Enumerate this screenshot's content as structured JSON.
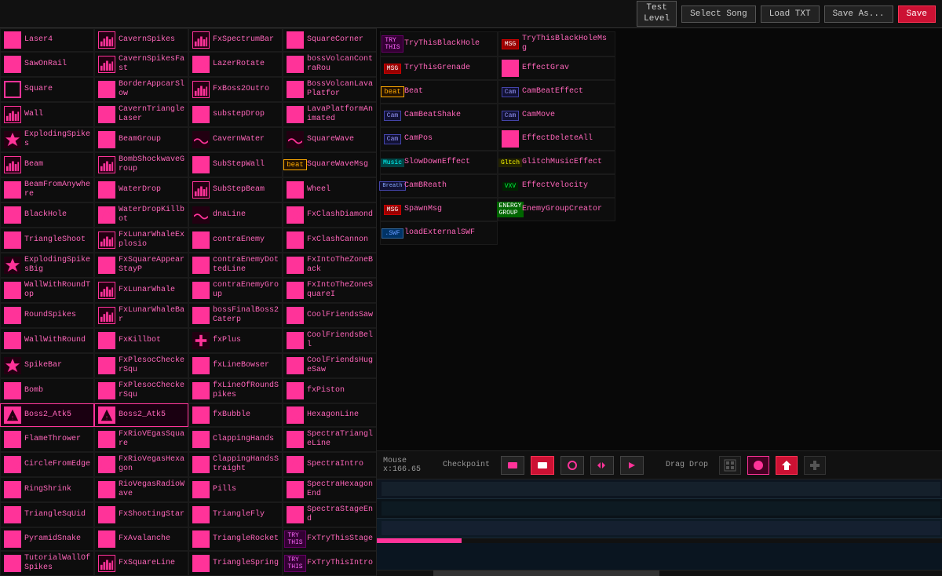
{
  "topbar": {
    "test_level": "Test\nLevel",
    "select_song": "Select Song",
    "load_txt": "Load TXT",
    "save_as": "Save As...",
    "save": "Save"
  },
  "mouse": {
    "label": "Mouse",
    "x": "x:166.65"
  },
  "checkpoint": "Checkpoint",
  "drag_drop": "Drag Drop",
  "items": [
    {
      "col": 0,
      "label": "Laser4",
      "icon": "diamond"
    },
    {
      "col": 1,
      "label": "CavernSpikes",
      "icon": "bars"
    },
    {
      "col": 2,
      "label": "FxSpectrumBar",
      "icon": "bars"
    },
    {
      "col": 3,
      "label": "SquareCorner",
      "icon": "sq"
    },
    {
      "col": 0,
      "label": "SawOnRail",
      "icon": "tri"
    },
    {
      "col": 1,
      "label": "CavernSpikesFast",
      "icon": "bars"
    },
    {
      "col": 2,
      "label": "LazerRotate",
      "icon": "ring"
    },
    {
      "col": 3,
      "label": "bossVolcanContraRou",
      "icon": "sq"
    },
    {
      "col": 0,
      "label": "Square",
      "icon": "sq-outline"
    },
    {
      "col": 1,
      "label": "BorderAppcarSlow",
      "icon": "sq"
    },
    {
      "col": 2,
      "label": "FxBoss2Outro",
      "icon": "bars"
    },
    {
      "col": 3,
      "label": "BossVolcanLavaPlatfor",
      "icon": "sq"
    },
    {
      "col": 0,
      "label": "Wall",
      "icon": "bars"
    },
    {
      "col": 1,
      "label": "CavernTriangleLaser",
      "icon": "tri"
    },
    {
      "col": 2,
      "label": "substepDrop",
      "icon": "tri"
    },
    {
      "col": 3,
      "label": "LavaPlatformAnimated",
      "icon": "sq"
    },
    {
      "col": 0,
      "label": "ExplodingSpikes",
      "icon": "spiky"
    },
    {
      "col": 1,
      "label": "BeamGroup",
      "icon": "ring"
    },
    {
      "col": 2,
      "label": "CavernWater",
      "icon": "wave"
    },
    {
      "col": 3,
      "label": "SquareWave",
      "icon": "wave"
    },
    {
      "col": 0,
      "label": "Beam",
      "icon": "bars"
    },
    {
      "col": 1,
      "label": "BombShockwaveGroup",
      "icon": "bars"
    },
    {
      "col": 2,
      "label": "SubStepWall",
      "icon": "sq"
    },
    {
      "col": 3,
      "label": "SquareWaveMsg",
      "icon": "sq",
      "badge": "beat"
    },
    {
      "col": 0,
      "label": "BeamFromAnywhere",
      "icon": "ring"
    },
    {
      "col": 1,
      "label": "WaterDrop",
      "icon": "drop"
    },
    {
      "col": 2,
      "label": "SubStepBeam",
      "icon": "bars"
    },
    {
      "col": 3,
      "label": "Wheel",
      "icon": "circle"
    },
    {
      "col": 0,
      "label": "BlackHole",
      "icon": "circle"
    },
    {
      "col": 1,
      "label": "WaterDropKillbot",
      "icon": "drop"
    },
    {
      "col": 2,
      "label": "dnaLine",
      "icon": "wave"
    },
    {
      "col": 3,
      "label": "FxClashDiamond",
      "icon": "diamond"
    },
    {
      "col": 0,
      "label": "TriangleShoot",
      "icon": "tri"
    },
    {
      "col": 1,
      "label": "FxLunarWhaleExplosio",
      "icon": "bars"
    },
    {
      "col": 2,
      "label": "contraEnemy",
      "icon": "sq"
    },
    {
      "col": 3,
      "label": "FxClashCannon",
      "icon": "sq"
    },
    {
      "col": 0,
      "label": "ExplodingSpikesBig",
      "icon": "spiky"
    },
    {
      "col": 1,
      "label": "FxSquareAppearStayP",
      "icon": "sq"
    },
    {
      "col": 2,
      "label": "contraEnemyDottedLine",
      "icon": "sq"
    },
    {
      "col": 3,
      "label": "FxIntoTheZoneBack",
      "icon": "sq"
    },
    {
      "col": 0,
      "label": "WallWithRoundTop",
      "icon": "sq"
    },
    {
      "col": 1,
      "label": "FxLunarWhale",
      "icon": "bars"
    },
    {
      "col": 2,
      "label": "contraEnemyGroup",
      "icon": "sq"
    },
    {
      "col": 3,
      "label": "FxIntoTheZoneSquareI",
      "icon": "sq"
    },
    {
      "col": 0,
      "label": "RoundSpikes",
      "icon": "circle"
    },
    {
      "col": 1,
      "label": "FxLunarWhaleBar",
      "icon": "bars"
    },
    {
      "col": 2,
      "label": "bossFinalBoss2Caterp",
      "icon": "sq"
    },
    {
      "col": 3,
      "label": "CoolFriendsSaw",
      "icon": "sq"
    },
    {
      "col": 0,
      "label": "WallWithRound",
      "icon": "sq"
    },
    {
      "col": 1,
      "label": "FxKillbot",
      "icon": "circle"
    },
    {
      "col": 2,
      "label": "fxPlus",
      "icon": "plus"
    },
    {
      "col": 3,
      "label": "CoolFriendsBell",
      "icon": "sq"
    },
    {
      "col": 0,
      "label": "SpikeBar",
      "icon": "spiky"
    },
    {
      "col": 1,
      "label": "FxPlesocCheckerSqu",
      "icon": "sq"
    },
    {
      "col": 2,
      "label": "fxLineBowser",
      "icon": "sq"
    },
    {
      "col": 3,
      "label": "CoolFriendsHugeSaw",
      "icon": "sq"
    },
    {
      "col": 0,
      "label": "Bomb",
      "icon": "circle"
    },
    {
      "col": 1,
      "label": "FxPlesocCheckerSqu",
      "icon": "sq"
    },
    {
      "col": 2,
      "label": "fxLineOfRoundSpikes",
      "icon": "sq"
    },
    {
      "col": 3,
      "label": "fxPiston",
      "icon": "sq"
    },
    {
      "col": 0,
      "label": "Boss2_Atk5",
      "icon": "boss",
      "highlighted": true
    },
    {
      "col": 1,
      "label": "Boss2_Atk5",
      "icon": "boss",
      "highlighted": true
    },
    {
      "col": 2,
      "label": "fxBubble",
      "icon": "circle"
    },
    {
      "col": 3,
      "label": "HexagonLine",
      "icon": "hex"
    },
    {
      "col": 0,
      "label": "FlameThrower",
      "icon": "diamond"
    },
    {
      "col": 1,
      "label": "FxRioVEgasSquare",
      "icon": "sq"
    },
    {
      "col": 2,
      "label": "ClappingHands",
      "icon": "sq"
    },
    {
      "col": 3,
      "label": "SpectraTriangleLine",
      "icon": "tri"
    },
    {
      "col": 0,
      "label": "CircleFromEdge",
      "icon": "ring"
    },
    {
      "col": 1,
      "label": "FxRioVegasHexagon",
      "icon": "hex"
    },
    {
      "col": 2,
      "label": "ClappingHandsStraight",
      "icon": "sq"
    },
    {
      "col": 3,
      "label": "SpectraIntro",
      "icon": "tri"
    },
    {
      "col": 0,
      "label": "RingShrink",
      "icon": "ring"
    },
    {
      "col": 1,
      "label": "RioVegasRadioWave",
      "icon": "circle"
    },
    {
      "col": 2,
      "label": "Pills",
      "icon": "sq"
    },
    {
      "col": 3,
      "label": "SpectraHexagonEnd",
      "icon": "hex"
    },
    {
      "col": 0,
      "label": "TriangleSqUid",
      "icon": "tri"
    },
    {
      "col": 1,
      "label": "FxShootingStar",
      "icon": "sq"
    },
    {
      "col": 2,
      "label": "TriangleFly",
      "icon": "tri"
    },
    {
      "col": 3,
      "label": "SpectraStageEnd",
      "icon": "sq"
    },
    {
      "col": 0,
      "label": "PyramidSnake",
      "icon": "tri"
    },
    {
      "col": 1,
      "label": "FxAvalanche",
      "icon": "sq"
    },
    {
      "col": 2,
      "label": "TriangleRocket",
      "icon": "tri"
    },
    {
      "col": 3,
      "label": "FxTryThisStage",
      "icon": "sq",
      "badge": "try"
    },
    {
      "col": 0,
      "label": "TutorialWallOfSpikes",
      "icon": "sq"
    },
    {
      "col": 1,
      "label": "FxSquareLine",
      "icon": "bars"
    },
    {
      "col": 2,
      "label": "TriangleSpring",
      "icon": "tri"
    },
    {
      "col": 3,
      "label": "FxTryThisIntro",
      "icon": "sq",
      "badge": "try"
    }
  ],
  "right_items": [
    {
      "label": "TryThisBlackHole",
      "icon": "sq",
      "badge": "try"
    },
    {
      "label": "TryThisBlackHoleMsg",
      "icon": "sq",
      "badge": "msg"
    },
    {
      "label": "TryThisGrenade",
      "icon": "sq",
      "badge": "msg"
    },
    {
      "label": "EffectGrav",
      "icon": "sq"
    },
    {
      "label": "Beat",
      "icon": "beat"
    },
    {
      "label": "CamBeatEffect",
      "icon": "sq",
      "badge": "cam"
    },
    {
      "label": "CamBeatShake",
      "icon": "sq",
      "badge": "cam"
    },
    {
      "label": "CamMove",
      "icon": "sq",
      "badge": "cam"
    },
    {
      "label": "CamPos",
      "icon": "sq",
      "badge": "cam"
    },
    {
      "label": "EffectDeleteAll",
      "icon": "sq"
    },
    {
      "label": "SlowDownEffect",
      "icon": "sq",
      "badge": "music"
    },
    {
      "label": "GlitchMusicEffect",
      "icon": "sq",
      "badge": "glitch"
    },
    {
      "label": "CamBReath",
      "icon": "sq",
      "badge": "breath"
    },
    {
      "label": "EffectVelocity",
      "icon": "sq",
      "badge": "vxv"
    },
    {
      "label": "SpawnMsg",
      "icon": "sq",
      "badge": "MSG"
    },
    {
      "label": "EnemyGroupCreator",
      "icon": "sq",
      "badge": "energy"
    },
    {
      "label": "loadExternalSWF",
      "icon": "sq",
      "badge": "swf"
    }
  ]
}
